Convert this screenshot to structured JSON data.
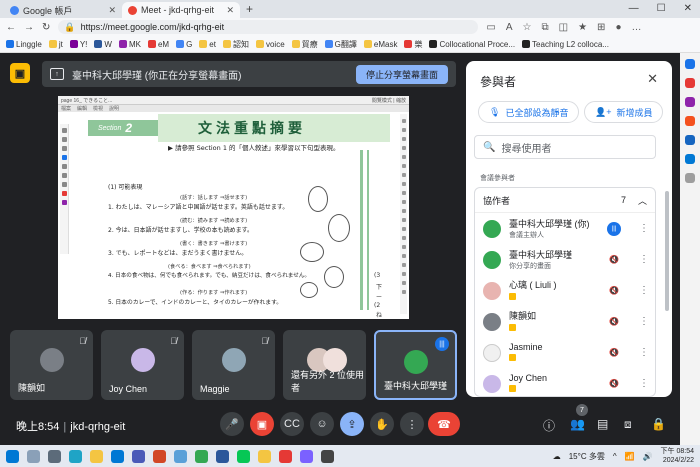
{
  "browser": {
    "tabs": [
      {
        "title": "Google 帳戶",
        "active": false,
        "favicon_color": "#4285f4"
      },
      {
        "title": "Meet - jkd-qrhg-eit",
        "active": true,
        "favicon_color": "#ea4335"
      }
    ],
    "new_tab": "+",
    "url": "https://meet.google.com/jkd-qrhg-eit",
    "bookmarks": [
      "Linggle",
      "jt",
      "Y!",
      "W",
      "MK",
      "eM",
      "G",
      "et",
      "認知",
      "voice",
      "貿療",
      "G翻譯",
      "eMask",
      "樂",
      "Collocational Proce...",
      "Teaching L2 colloca..."
    ],
    "window_controls": [
      "—",
      "☐",
      "✕"
    ]
  },
  "meet": {
    "share_banner_text": "臺中科大邱學瑾 (你正在分享螢幕畫面)",
    "stop_share_label": "停止分享螢幕畫面",
    "shared_screen": {
      "toolbar_left": "page 16_ できること...",
      "toolbar_right": "閱覽模式 | 縮放",
      "menu": [
        "檔案",
        "編輯",
        "檢視",
        "說明"
      ],
      "section_label": "Section",
      "section_number": "2",
      "title": "文法重點摘要",
      "instruction": "▶ 請參照 Section 1 的「個人敘述」來學習以下句型表現。",
      "subheading": "(1) 可能表現",
      "examples": [
        {
          "cue": "(話す：話します ⇒話せます)",
          "text": "1. わたしは、マレーシア語と中国語が話せます。英語も話せます。"
        },
        {
          "cue": "(読む：読みます ⇒読めます)",
          "text": "2. 今は、日本語が話せますし、学校の本も読めます。"
        },
        {
          "cue": "(書く：書きます ⇒書けます)",
          "text": "3. でも、レポートなどは、まだうまく書けません。"
        },
        {
          "cue": "(食べる：食べます ⇒食べられます)",
          "text": "4. 日本の食べ物は、何でも食べられます。でも、納豆だけは、食べられません。"
        },
        {
          "cue": "(作る：作ります ⇒作れます)",
          "text": "5. 日本のカレーで、インドのカレーと、タイのカレーが作れます。"
        }
      ],
      "side_numbers": [
        "(3",
        "下",
        "ー",
        "(2",
        "ね"
      ]
    },
    "tiles": [
      {
        "name": "陳韻如",
        "muted": true,
        "avatar_color": "#7a7f86"
      },
      {
        "name": "Joy Chen",
        "muted": true,
        "avatar_color": "#c9b8e8"
      },
      {
        "name": "Maggie",
        "muted": true,
        "avatar_color": "#8fa6b5"
      },
      {
        "name": "還有另外 2 位使用者",
        "muted": false,
        "avatar_color": "#d9c7c0"
      },
      {
        "name": "臺中科大邱學瑾",
        "muted": false,
        "avatar_color": "#34a853"
      }
    ],
    "clock": "晚上8:54",
    "meeting_code": "jkd-qrhg-eit",
    "controls": [
      "mic-icon",
      "camera-off-icon",
      "captions-icon",
      "emoji-icon",
      "present-icon",
      "raise-hand-icon",
      "more-icon",
      "end-call-icon"
    ],
    "right_controls": [
      "info-icon",
      "people-icon",
      "chat-icon",
      "activities-icon",
      "host-controls-icon"
    ],
    "people_count_badge": "7"
  },
  "panel": {
    "title": "參與者",
    "mute_all_label": "已全部設為靜音",
    "add_person_label": "新增成員",
    "search_placeholder": "搜尋使用者",
    "section_label": "會議參與者",
    "group_label": "協作者",
    "group_count": "7",
    "people": [
      {
        "name": "臺中科大邱學瑾 (你)",
        "role": "會議主辦人",
        "mic": "speaking",
        "avatar_color": "#34a853"
      },
      {
        "name": "臺中科大邱學瑾",
        "role": "你分享的畫面",
        "mic": "off",
        "avatar_color": "#34a853"
      },
      {
        "name": "心璃 ( Liuli )",
        "role": "",
        "mic": "off",
        "avatar_color": "#e8b4b0"
      },
      {
        "name": "陳韻如",
        "role": "",
        "mic": "off",
        "avatar_color": "#7a7f86"
      },
      {
        "name": "Jasmine",
        "role": "",
        "mic": "off",
        "avatar_color": "#f0f0f0"
      },
      {
        "name": "Joy Chen",
        "role": "",
        "mic": "off",
        "avatar_color": "#c9b8e8"
      }
    ]
  },
  "taskbar": {
    "weather": "15°C 多雲",
    "time": "下午 08:54",
    "date": "2024/2/22"
  }
}
